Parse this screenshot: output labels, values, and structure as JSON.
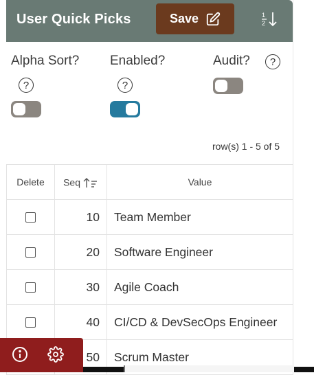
{
  "header": {
    "title": "User Quick Picks",
    "save_label": "Save",
    "save_icon": "edit-icon",
    "sort_icon": "sort-numeric-icon",
    "bg_color": "#697a74",
    "save_color": "#6b3a1e"
  },
  "switches": {
    "alpha_sort": {
      "label": "Alpha Sort?",
      "help": "?",
      "state": "off"
    },
    "enabled": {
      "label": "Enabled?",
      "help": "?",
      "state": "on"
    },
    "audit": {
      "label": "Audit?",
      "help": "?",
      "state": "off"
    }
  },
  "report": {
    "row_count": "row(s) 1 - 5 of 5",
    "columns": {
      "delete": "Delete",
      "seq": "Seq",
      "value": "Value"
    },
    "rows": [
      {
        "seq": "10",
        "value": "Team Member"
      },
      {
        "seq": "20",
        "value": "Software Engineer"
      },
      {
        "seq": "30",
        "value": "Agile Coach"
      },
      {
        "seq": "40",
        "value": "CI/CD & DevSecOps Engineer"
      },
      {
        "seq": "50",
        "value": "Scrum Master"
      }
    ]
  },
  "developer_toolbar": {
    "info_icon": "info-icon",
    "settings_icon": "gear-icon",
    "color": "#8f1d1d"
  }
}
